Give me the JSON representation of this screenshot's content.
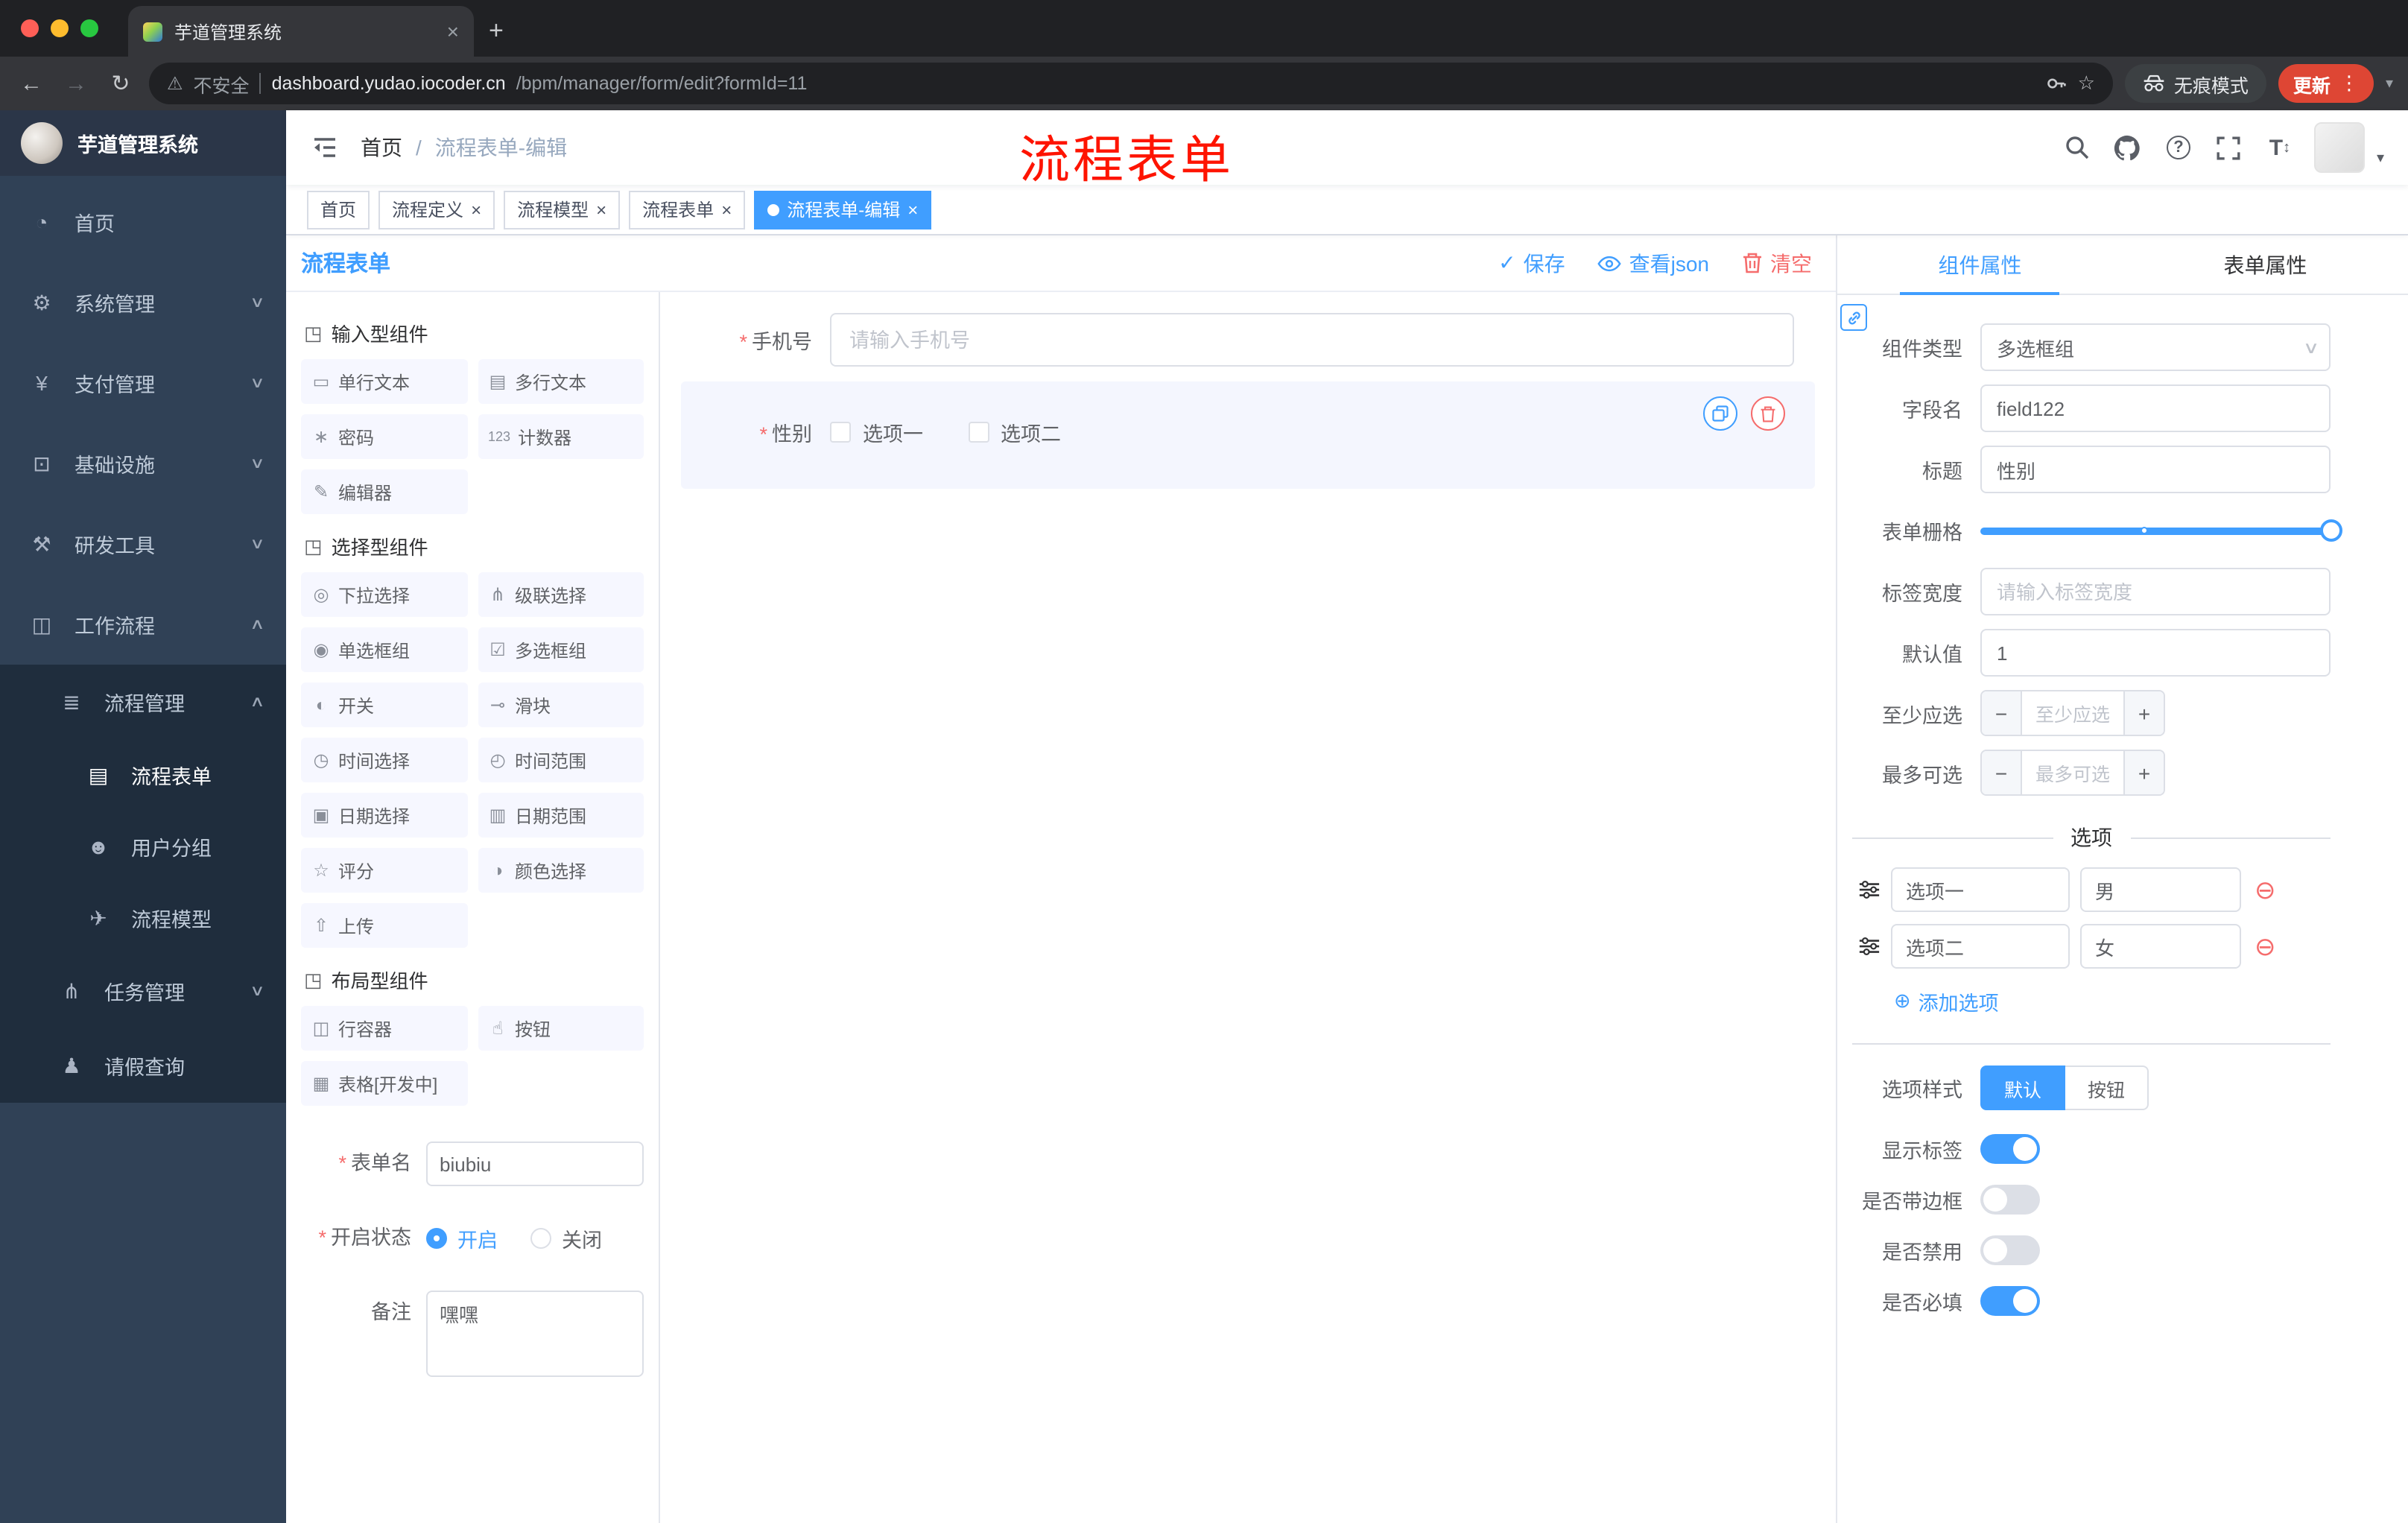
{
  "browser": {
    "tab_title": "芋道管理系统",
    "toolbar": {
      "security_label": "不安全",
      "url_domain": "dashboard.yudao.iocoder.cn",
      "url_path": "/bpm/manager/form/edit?formId=11",
      "incognito_label": "无痕模式",
      "update_label": "更新"
    }
  },
  "glyphs": {
    "close": "×",
    "plus": "+",
    "minus": "−",
    "chevron_down": "∨",
    "chevron_up": "∧",
    "caret_down": "▾",
    "back": "←",
    "forward": "→",
    "reload": "↻",
    "warning": "⚠",
    "star": "☆",
    "dots_vertical": "⋮",
    "question": "?",
    "letter_T": "T",
    "updown": "↕",
    "check": "✓",
    "add_circle": "⊕",
    "remove_circle": "⊖",
    "asterisk": "*",
    "dot": "●"
  },
  "annotation": {
    "text": "流程表单",
    "color": "#fe1400"
  },
  "sidebar": {
    "logo_title": "芋道管理系统",
    "menu": [
      {
        "label": "首页",
        "glyph": "◔",
        "icon": "dashboard-icon"
      },
      {
        "label": "系统管理",
        "glyph": "⚙",
        "icon": "gear-icon"
      },
      {
        "label": "支付管理",
        "glyph": "¥",
        "icon": "payment-icon"
      },
      {
        "label": "基础设施",
        "glyph": "⊡",
        "icon": "infrastructure-icon"
      },
      {
        "label": "研发工具",
        "glyph": "⚒",
        "icon": "dev-tools-icon"
      },
      {
        "label": "工作流程",
        "glyph": "◫",
        "icon": "workflow-icon"
      }
    ],
    "sub": [
      {
        "label": "流程管理",
        "glyph": "≣",
        "icon": "process-management-icon"
      },
      {
        "label": "流程表单",
        "glyph": "▤",
        "icon": "process-form-icon",
        "active": true
      },
      {
        "label": "用户分组",
        "glyph": "☻",
        "icon": "user-group-icon"
      },
      {
        "label": "流程模型",
        "glyph": "✈",
        "icon": "process-model-icon"
      },
      {
        "label": "任务管理",
        "glyph": "⋔",
        "icon": "task-management-icon"
      },
      {
        "label": "请假查询",
        "glyph": "♟",
        "icon": "leave-query-icon"
      }
    ]
  },
  "navbar": {
    "breadcrumb": {
      "home": "首页",
      "separator": "/",
      "current": "流程表单-编辑"
    }
  },
  "tags": [
    {
      "label": "首页"
    },
    {
      "label": "流程定义"
    },
    {
      "label": "流程模型"
    },
    {
      "label": "流程表单"
    },
    {
      "label": "流程表单-编辑",
      "active": true
    }
  ],
  "designer": {
    "title": "流程表单",
    "actions": {
      "save": "保存",
      "view_json": "查看json",
      "clear": "清空"
    },
    "palette": {
      "sections": [
        {
          "title": "输入型组件",
          "items": [
            {
              "label": "单行文本",
              "glyph": "▭",
              "icon": "text-field-icon"
            },
            {
              "label": "多行文本",
              "glyph": "▤",
              "icon": "textarea-icon"
            },
            {
              "label": "密码",
              "glyph": "∗",
              "icon": "password-icon"
            },
            {
              "label": "计数器",
              "glyph": "123",
              "icon": "counter-icon"
            },
            {
              "label": "编辑器",
              "glyph": "✎",
              "icon": "editor-icon"
            }
          ]
        },
        {
          "title": "选择型组件",
          "items": [
            {
              "label": "下拉选择",
              "glyph": "◎",
              "icon": "select-icon"
            },
            {
              "label": "级联选择",
              "glyph": "⋔",
              "icon": "cascader-icon"
            },
            {
              "label": "单选框组",
              "glyph": "◉",
              "icon": "radio-group-icon"
            },
            {
              "label": "多选框组",
              "glyph": "☑",
              "icon": "checkbox-group-icon"
            },
            {
              "label": "开关",
              "glyph": "◐",
              "icon": "switch-icon"
            },
            {
              "label": "滑块",
              "glyph": "⊸",
              "icon": "slider-icon"
            },
            {
              "label": "时间选择",
              "glyph": "◷",
              "icon": "time-picker-icon"
            },
            {
              "label": "时间范围",
              "glyph": "◴",
              "icon": "time-range-icon"
            },
            {
              "label": "日期选择",
              "glyph": "▣",
              "icon": "date-picker-icon"
            },
            {
              "label": "日期范围",
              "glyph": "▥",
              "icon": "date-range-icon"
            },
            {
              "label": "评分",
              "glyph": "☆",
              "icon": "rate-icon"
            },
            {
              "label": "颜色选择",
              "glyph": "◑",
              "icon": "color-picker-icon"
            },
            {
              "label": "上传",
              "glyph": "⇧",
              "icon": "upload-icon"
            }
          ]
        },
        {
          "title": "布局型组件",
          "items": [
            {
              "label": "行容器",
              "glyph": "◫",
              "icon": "row-container-icon"
            },
            {
              "label": "按钮",
              "glyph": "☝",
              "icon": "button-icon"
            },
            {
              "label": "表格[开发中]",
              "glyph": "▦",
              "icon": "table-icon"
            }
          ]
        }
      ],
      "form": {
        "name_label": "表单名",
        "name_value": "biubiu",
        "status_label": "开启状态",
        "status_on": "开启",
        "status_off": "关闭",
        "remark_label": "备注",
        "remark_value": "嘿嘿"
      }
    },
    "canvas": {
      "phone": {
        "label": "手机号",
        "placeholder": "请输入手机号"
      },
      "gender": {
        "label": "性别",
        "option1": "选项一",
        "option2": "选项二"
      }
    },
    "props": {
      "tab_component": "组件属性",
      "tab_form": "表单属性",
      "fields": {
        "type_label": "组件类型",
        "type_value": "多选框组",
        "field_label": "字段名",
        "field_value": "field122",
        "title_label": "标题",
        "title_value": "性别",
        "grid_label": "表单栅格",
        "labelwidth_label": "标签宽度",
        "labelwidth_placeholder": "请输入标签宽度",
        "default_label": "默认值",
        "default_value": "1",
        "min_label": "至少应选",
        "min_placeholder": "至少应选",
        "max_label": "最多可选",
        "max_placeholder": "最多可选"
      },
      "options": {
        "divider": "选项",
        "rows": [
          {
            "label": "选项一",
            "value": "男"
          },
          {
            "label": "选项二",
            "value": "女"
          }
        ],
        "add": "添加选项"
      },
      "style": {
        "label": "选项样式",
        "default_btn": "默认",
        "button_btn": "按钮"
      },
      "switches": [
        {
          "label": "显示标签",
          "state": "on"
        },
        {
          "label": "是否带边框",
          "state": "off"
        },
        {
          "label": "是否禁用",
          "state": "off"
        },
        {
          "label": "是否必填",
          "state": "on"
        }
      ]
    }
  },
  "colors": {
    "accent": "#409EFF",
    "danger": "#F56C6C",
    "sidebar_bg": "#304156",
    "submenu_bg": "#1F2D3D",
    "update_pill": "#DE4634"
  }
}
